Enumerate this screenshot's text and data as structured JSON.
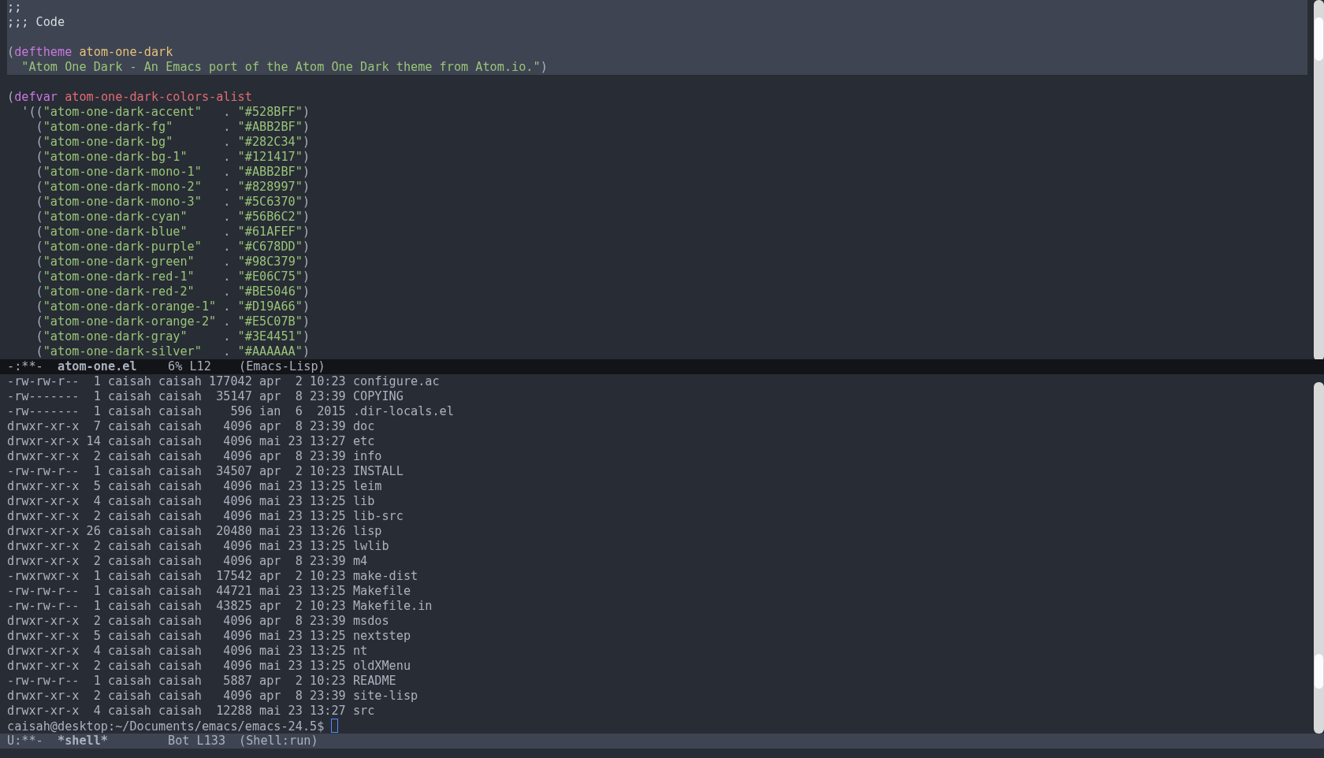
{
  "code_buffer": {
    "lines": [
      {
        "highlighted": true,
        "segments": [
          {
            "kind": "comment",
            "text": ";;"
          }
        ]
      },
      {
        "highlighted": true,
        "segments": [
          {
            "kind": "comment",
            "text": ";;; Code"
          }
        ]
      },
      {
        "highlighted": true
      },
      {
        "highlighted": true,
        "segments": [
          {
            "kind": "plain",
            "text": "("
          },
          {
            "kind": "keyword",
            "text": "deftheme"
          },
          {
            "kind": "type",
            "text": " atom-one-dark"
          }
        ]
      },
      {
        "highlighted": true,
        "segments": [
          {
            "kind": "string",
            "text": "  \"Atom One Dark - An Emacs port of the Atom One Dark theme from Atom.io.\""
          },
          {
            "kind": "plain",
            "text": ")"
          }
        ]
      },
      {
        "highlighted": false
      },
      {
        "highlighted": false,
        "segments": [
          {
            "kind": "plain",
            "text": "("
          },
          {
            "kind": "keyword",
            "text": "defvar"
          },
          {
            "kind": "variable",
            "text": " atom-one-dark-colors-alist"
          }
        ]
      },
      {
        "highlighted": false,
        "segments": [
          {
            "kind": "plain",
            "text": "  '(("
          },
          {
            "kind": "string",
            "text": "\"atom-one-dark-accent\""
          },
          {
            "kind": "plain",
            "text": "   . "
          },
          {
            "kind": "string",
            "text": "\"#528BFF\""
          },
          {
            "kind": "plain",
            "text": ")"
          }
        ]
      },
      {
        "highlighted": false,
        "segments": [
          {
            "kind": "plain",
            "text": "    ("
          },
          {
            "kind": "string",
            "text": "\"atom-one-dark-fg\""
          },
          {
            "kind": "plain",
            "text": "       . "
          },
          {
            "kind": "string",
            "text": "\"#ABB2BF\""
          },
          {
            "kind": "plain",
            "text": ")"
          }
        ]
      },
      {
        "highlighted": false,
        "segments": [
          {
            "kind": "plain",
            "text": "    ("
          },
          {
            "kind": "string",
            "text": "\"atom-one-dark-bg\""
          },
          {
            "kind": "plain",
            "text": "       . "
          },
          {
            "kind": "string",
            "text": "\"#282C34\""
          },
          {
            "kind": "plain",
            "text": ")"
          }
        ]
      },
      {
        "highlighted": false,
        "segments": [
          {
            "kind": "plain",
            "text": "    ("
          },
          {
            "kind": "string",
            "text": "\"atom-one-dark-bg-1\""
          },
          {
            "kind": "plain",
            "text": "     . "
          },
          {
            "kind": "string",
            "text": "\"#121417\""
          },
          {
            "kind": "plain",
            "text": ")"
          }
        ]
      },
      {
        "highlighted": false,
        "segments": [
          {
            "kind": "plain",
            "text": "    ("
          },
          {
            "kind": "string",
            "text": "\"atom-one-dark-mono-1\""
          },
          {
            "kind": "plain",
            "text": "   . "
          },
          {
            "kind": "string",
            "text": "\"#ABB2BF\""
          },
          {
            "kind": "plain",
            "text": ")"
          }
        ]
      },
      {
        "highlighted": false,
        "segments": [
          {
            "kind": "plain",
            "text": "    ("
          },
          {
            "kind": "string",
            "text": "\"atom-one-dark-mono-2\""
          },
          {
            "kind": "plain",
            "text": "   . "
          },
          {
            "kind": "string",
            "text": "\"#828997\""
          },
          {
            "kind": "plain",
            "text": ")"
          }
        ]
      },
      {
        "highlighted": false,
        "segments": [
          {
            "kind": "plain",
            "text": "    ("
          },
          {
            "kind": "string",
            "text": "\"atom-one-dark-mono-3\""
          },
          {
            "kind": "plain",
            "text": "   . "
          },
          {
            "kind": "string",
            "text": "\"#5C6370\""
          },
          {
            "kind": "plain",
            "text": ")"
          }
        ]
      },
      {
        "highlighted": false,
        "segments": [
          {
            "kind": "plain",
            "text": "    ("
          },
          {
            "kind": "string",
            "text": "\"atom-one-dark-cyan\""
          },
          {
            "kind": "plain",
            "text": "     . "
          },
          {
            "kind": "string",
            "text": "\"#56B6C2\""
          },
          {
            "kind": "plain",
            "text": ")"
          }
        ]
      },
      {
        "highlighted": false,
        "segments": [
          {
            "kind": "plain",
            "text": "    ("
          },
          {
            "kind": "string",
            "text": "\"atom-one-dark-blue\""
          },
          {
            "kind": "plain",
            "text": "     . "
          },
          {
            "kind": "string",
            "text": "\"#61AFEF\""
          },
          {
            "kind": "plain",
            "text": ")"
          }
        ]
      },
      {
        "highlighted": false,
        "segments": [
          {
            "kind": "plain",
            "text": "    ("
          },
          {
            "kind": "string",
            "text": "\"atom-one-dark-purple\""
          },
          {
            "kind": "plain",
            "text": "   . "
          },
          {
            "kind": "string",
            "text": "\"#C678DD\""
          },
          {
            "kind": "plain",
            "text": ")"
          }
        ]
      },
      {
        "highlighted": false,
        "segments": [
          {
            "kind": "plain",
            "text": "    ("
          },
          {
            "kind": "string",
            "text": "\"atom-one-dark-green\""
          },
          {
            "kind": "plain",
            "text": "    . "
          },
          {
            "kind": "string",
            "text": "\"#98C379\""
          },
          {
            "kind": "plain",
            "text": ")"
          }
        ]
      },
      {
        "highlighted": false,
        "segments": [
          {
            "kind": "plain",
            "text": "    ("
          },
          {
            "kind": "string",
            "text": "\"atom-one-dark-red-1\""
          },
          {
            "kind": "plain",
            "text": "    . "
          },
          {
            "kind": "string",
            "text": "\"#E06C75\""
          },
          {
            "kind": "plain",
            "text": ")"
          }
        ]
      },
      {
        "highlighted": false,
        "segments": [
          {
            "kind": "plain",
            "text": "    ("
          },
          {
            "kind": "string",
            "text": "\"atom-one-dark-red-2\""
          },
          {
            "kind": "plain",
            "text": "    . "
          },
          {
            "kind": "string",
            "text": "\"#BE5046\""
          },
          {
            "kind": "plain",
            "text": ")"
          }
        ]
      },
      {
        "highlighted": false,
        "segments": [
          {
            "kind": "plain",
            "text": "    ("
          },
          {
            "kind": "string",
            "text": "\"atom-one-dark-orange-1\""
          },
          {
            "kind": "plain",
            "text": " . "
          },
          {
            "kind": "string",
            "text": "\"#D19A66\""
          },
          {
            "kind": "plain",
            "text": ")"
          }
        ]
      },
      {
        "highlighted": false,
        "segments": [
          {
            "kind": "plain",
            "text": "    ("
          },
          {
            "kind": "string",
            "text": "\"atom-one-dark-orange-2\""
          },
          {
            "kind": "plain",
            "text": " . "
          },
          {
            "kind": "string",
            "text": "\"#E5C07B\""
          },
          {
            "kind": "plain",
            "text": ")"
          }
        ]
      },
      {
        "highlighted": false,
        "segments": [
          {
            "kind": "plain",
            "text": "    ("
          },
          {
            "kind": "string",
            "text": "\"atom-one-dark-gray\""
          },
          {
            "kind": "plain",
            "text": "     . "
          },
          {
            "kind": "string",
            "text": "\"#3E4451\""
          },
          {
            "kind": "plain",
            "text": ")"
          }
        ]
      },
      {
        "highlighted": false,
        "segments": [
          {
            "kind": "plain",
            "text": "    ("
          },
          {
            "kind": "string",
            "text": "\"atom-one-dark-silver\""
          },
          {
            "kind": "plain",
            "text": "   . "
          },
          {
            "kind": "string",
            "text": "\"#AAAAAA\""
          },
          {
            "kind": "plain",
            "text": ")"
          }
        ]
      }
    ]
  },
  "code_mode_line": {
    "active": false,
    "state": "-:**-",
    "buffer": "atom-one.el",
    "position": "6% L12",
    "mode": "(Emacs-Lisp)"
  },
  "shell_buffer": {
    "lines": [
      "-rw-rw-r--  1 caisah caisah 177042 apr  2 10:23 configure.ac",
      "-rw-------  1 caisah caisah  35147 apr  8 23:39 COPYING",
      "-rw-------  1 caisah caisah    596 ian  6  2015 .dir-locals.el",
      "drwxr-xr-x  7 caisah caisah   4096 apr  8 23:39 doc",
      "drwxr-xr-x 14 caisah caisah   4096 mai 23 13:27 etc",
      "drwxr-xr-x  2 caisah caisah   4096 apr  8 23:39 info",
      "-rw-rw-r--  1 caisah caisah  34507 apr  2 10:23 INSTALL",
      "drwxr-xr-x  5 caisah caisah   4096 mai 23 13:25 leim",
      "drwxr-xr-x  4 caisah caisah   4096 mai 23 13:25 lib",
      "drwxr-xr-x  2 caisah caisah   4096 mai 23 13:25 lib-src",
      "drwxr-xr-x 26 caisah caisah  20480 mai 23 13:26 lisp",
      "drwxr-xr-x  2 caisah caisah   4096 mai 23 13:25 lwlib",
      "drwxr-xr-x  2 caisah caisah   4096 apr  8 23:39 m4",
      "-rwxrwxr-x  1 caisah caisah  17542 apr  2 10:23 make-dist",
      "-rw-rw-r--  1 caisah caisah  44721 mai 23 13:25 Makefile",
      "-rw-rw-r--  1 caisah caisah  43825 apr  2 10:23 Makefile.in",
      "drwxr-xr-x  2 caisah caisah   4096 apr  8 23:39 msdos",
      "drwxr-xr-x  5 caisah caisah   4096 mai 23 13:25 nextstep",
      "drwxr-xr-x  4 caisah caisah   4096 mai 23 13:25 nt",
      "drwxr-xr-x  2 caisah caisah   4096 mai 23 13:25 oldXMenu",
      "-rw-rw-r--  1 caisah caisah   5887 apr  2 10:23 README",
      "drwxr-xr-x  2 caisah caisah   4096 apr  8 23:39 site-lisp",
      "drwxr-xr-x  4 caisah caisah  12288 mai 23 13:27 src"
    ],
    "prompt": "caisah@desktop:~/Documents/emacs/emacs-24.5$"
  },
  "shell_mode_line": {
    "active": true,
    "state": "U:**-",
    "buffer": "*shell*",
    "position": "Bot L133",
    "mode": "(Shell:run)"
  }
}
